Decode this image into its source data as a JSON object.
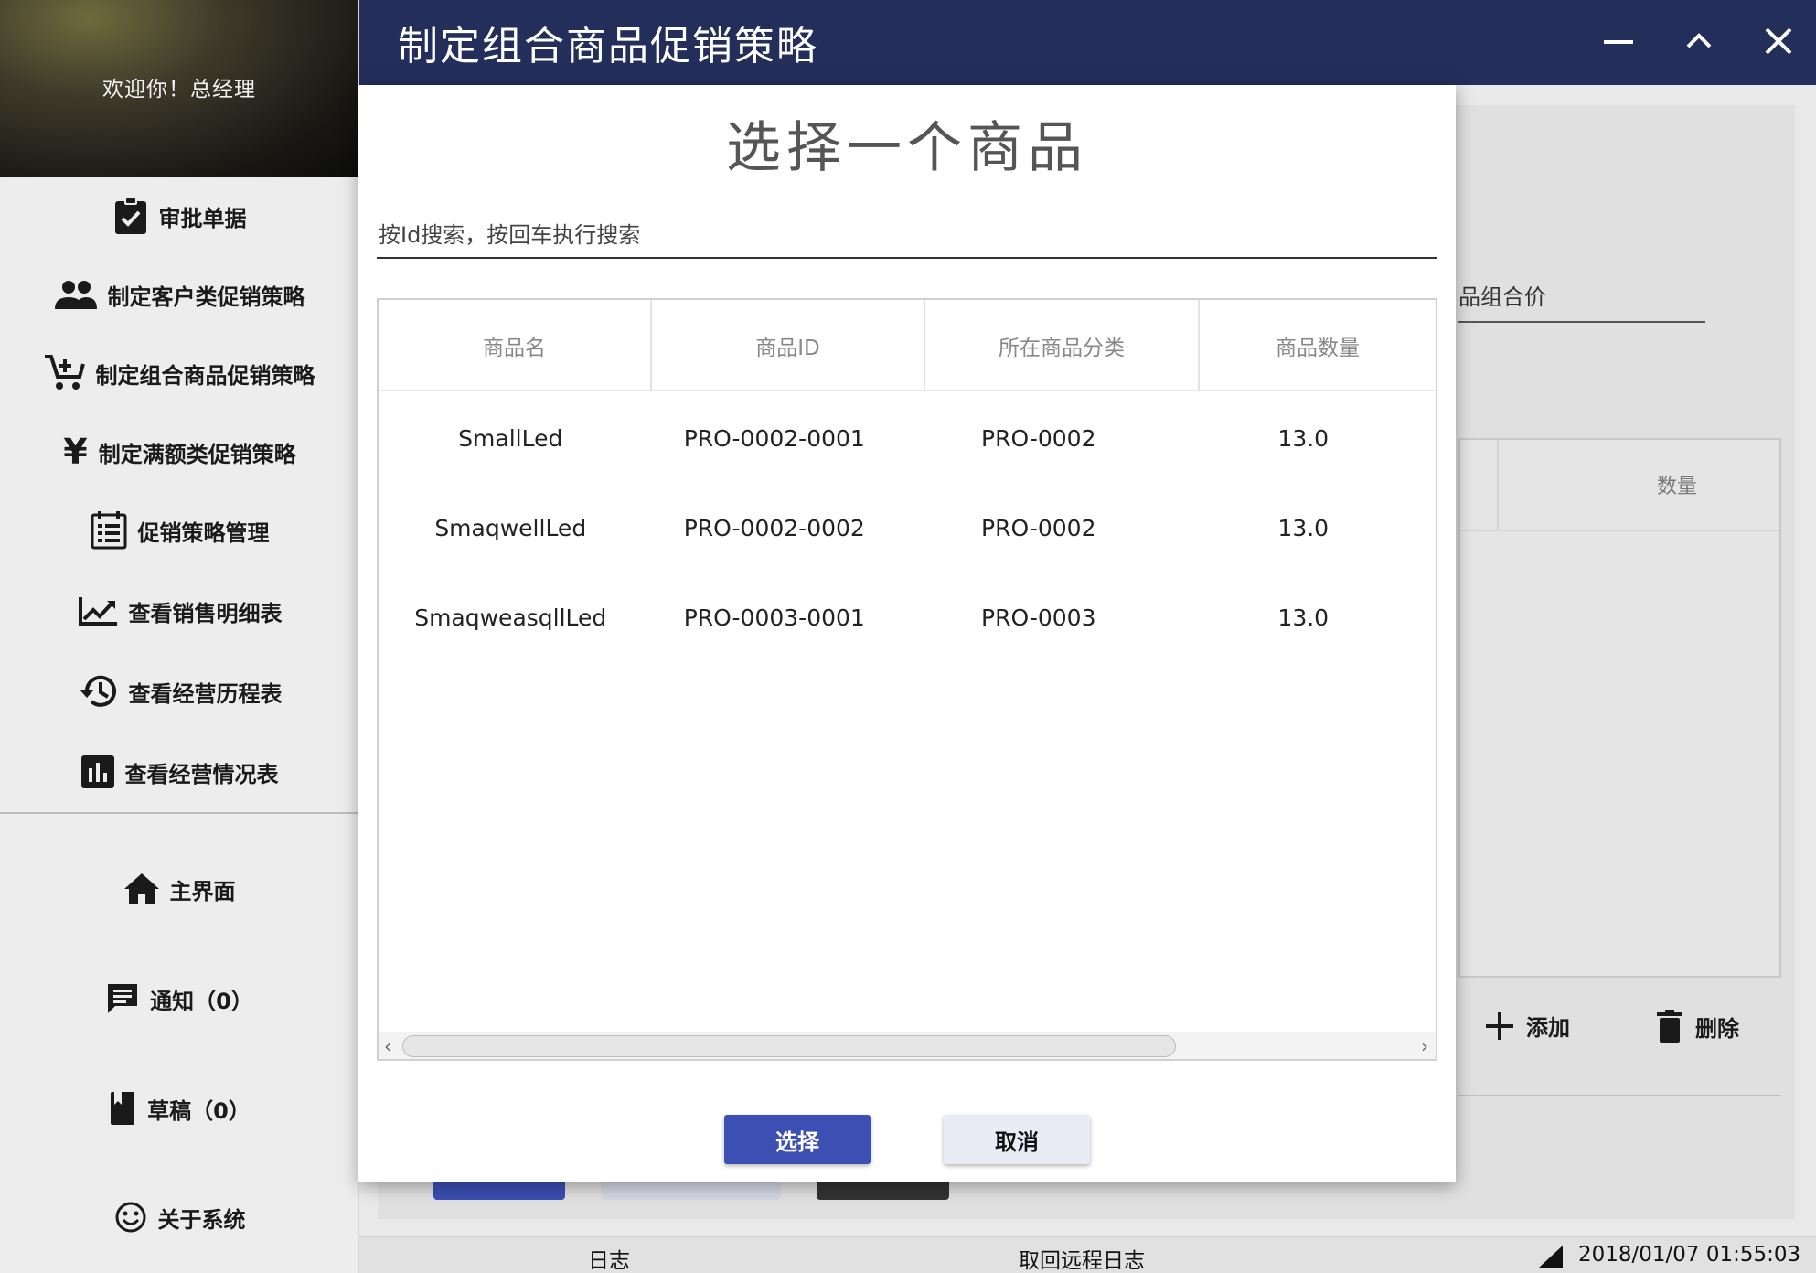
{
  "app": {
    "title": "制定组合商品促销策略",
    "welcome": "欢迎你！总经理"
  },
  "sidebar": {
    "items": [
      {
        "label": "审批单据",
        "icon": "clipboard-check-icon"
      },
      {
        "label": "制定客户类促销策略",
        "icon": "people-icon"
      },
      {
        "label": "制定组合商品促销策略",
        "icon": "cart-add-icon"
      },
      {
        "label": "制定满额类促销策略",
        "icon": "yen-icon"
      },
      {
        "label": "促销策略管理",
        "icon": "list-board-icon"
      },
      {
        "label": "查看销售明细表",
        "icon": "trending-up-icon"
      },
      {
        "label": "查看经营历程表",
        "icon": "history-icon"
      },
      {
        "label": "查看经营情况表",
        "icon": "bar-chart-icon"
      }
    ],
    "bottom": [
      {
        "label": "主界面",
        "icon": "home-icon"
      },
      {
        "label": "通知（0）",
        "icon": "message-icon"
      },
      {
        "label": "草稿（0）",
        "icon": "book-icon"
      },
      {
        "label": "关于系统",
        "icon": "smiley-icon"
      }
    ]
  },
  "window_controls": [
    "minimize-icon",
    "maximize-icon",
    "close-icon"
  ],
  "background": {
    "field_label": "品组合价",
    "table_header": "数量",
    "add_label": "添加",
    "delete_label": "删除"
  },
  "dialog": {
    "title": "选择一个商品",
    "search_placeholder": "按Id搜索，按回车执行搜索",
    "columns": [
      "商品名",
      "商品ID",
      "所在商品分类",
      "商品数量"
    ],
    "rows": [
      [
        "SmallLed",
        "PRO-0002-0001",
        "PRO-0002",
        "13.0"
      ],
      [
        "SmaqwellLed",
        "PRO-0002-0002",
        "PRO-0002",
        "13.0"
      ],
      [
        "SmaqweasqllLed",
        "PRO-0003-0001",
        "PRO-0003",
        "13.0"
      ]
    ],
    "select_label": "选择",
    "cancel_label": "取消"
  },
  "statusbar": {
    "log": "日志",
    "remote_log": "取回远程日志",
    "datetime": "2018/01/07 01:55:03"
  },
  "colors": {
    "titlebar": "#232e5b",
    "primary_button": "#3c4fb3",
    "secondary_button": "#e9ebf5"
  }
}
